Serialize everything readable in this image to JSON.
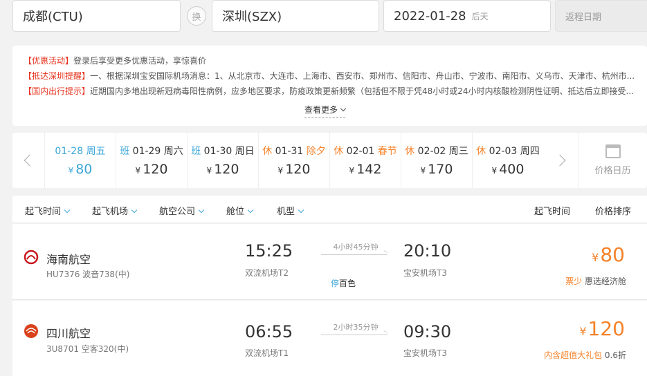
{
  "search": {
    "from": "成都(CTU)",
    "swap": "换",
    "to": "深圳(SZX)",
    "date": "2022-01-28",
    "date_hint": "后天",
    "return_placeholder": "返程日期"
  },
  "notices": [
    {
      "tag": "【优惠活动】",
      "text": "登录后享受更多优惠活动，享惊喜价"
    },
    {
      "tag": "【抵达深圳提醒】",
      "text": "一、根据深圳宝安国际机场消息：1、从北京市、大连市、上海市、西安市、郑州市、信阳市、舟山市、宁波市、南阳市、义乌市、天津市、杭州市..."
    },
    {
      "tag": "【国内出行提示】",
      "text": "近期国内多地出现新冠病毒阳性病例，应多地区要求，防疫政策更新频繁（包括但不限于凭48小时或24小时内核酸检测阴性证明、抵达后立即接受..."
    }
  ],
  "more_label": "查看更多",
  "dates": [
    {
      "tag": "",
      "date": "01-28",
      "week": "周五",
      "festival": "",
      "price": "80",
      "selected": true
    },
    {
      "tag": "班",
      "date": "01-29",
      "week": "周六",
      "festival": "",
      "price": "120"
    },
    {
      "tag": "班",
      "date": "01-30",
      "week": "周日",
      "festival": "",
      "price": "120"
    },
    {
      "tag": "休",
      "date": "01-31",
      "week": "",
      "festival": "除夕",
      "price": "120"
    },
    {
      "tag": "休",
      "date": "02-01",
      "week": "",
      "festival": "春节",
      "price": "142"
    },
    {
      "tag": "休",
      "date": "02-02",
      "week": "周三",
      "festival": "",
      "price": "170"
    },
    {
      "tag": "休",
      "date": "02-03",
      "week": "周四",
      "festival": "",
      "price": "400"
    }
  ],
  "currency": "¥",
  "calendar_label": "价格日历",
  "filters": [
    "起飞时间",
    "起飞机场",
    "航空公司",
    "舱位",
    "机型"
  ],
  "sorts": [
    "起飞时间",
    "价格排序"
  ],
  "flights": [
    {
      "airline": "海南航空",
      "flight_no": "HU7376 波音738(中)",
      "dep_time": "15:25",
      "dep_airport": "双流机场T2",
      "duration": "4小时45分钟",
      "stop_label": "停",
      "stop_city": "百色",
      "arr_time": "20:10",
      "arr_airport": "宝安机场T3",
      "price": "80",
      "note_highlight": "票少",
      "note": "惠选经济舱",
      "logo_color": "#c8161d"
    },
    {
      "airline": "四川航空",
      "flight_no": "3U8701 空客320(中)",
      "dep_time": "06:55",
      "dep_airport": "双流机场T1",
      "duration": "2小时35分钟",
      "stop_label": "",
      "stop_city": "",
      "arr_time": "09:30",
      "arr_airport": "宝安机场T3",
      "price": "120",
      "note_highlight": "内含超值大礼包",
      "note": "0.6折",
      "logo_color": "#d9421b"
    }
  ]
}
